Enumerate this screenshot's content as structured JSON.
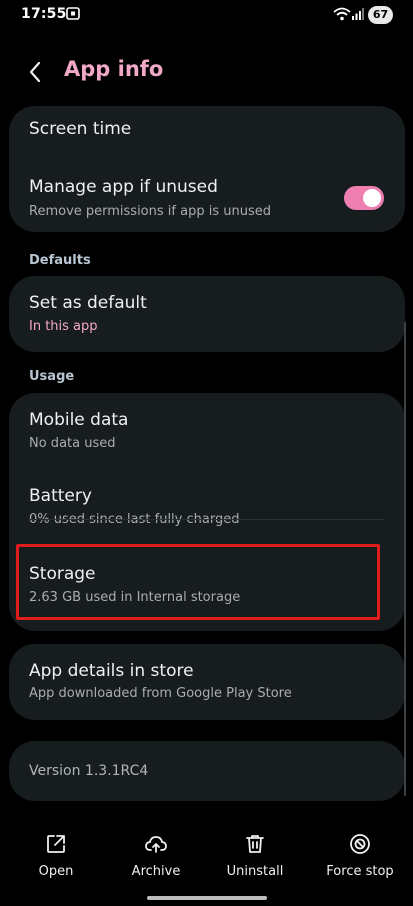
{
  "status_bar": {
    "time": "17:55",
    "battery": "67"
  },
  "header": {
    "title": "App info"
  },
  "items": {
    "screen_time": {
      "label": "Screen time"
    },
    "manage_unused": {
      "label": "Manage app if unused",
      "sub": "Remove permissions if app is unused",
      "enabled": true
    },
    "set_default": {
      "label": "Set as default",
      "sub": "In this app"
    },
    "mobile_data": {
      "label": "Mobile data",
      "sub": "No data used"
    },
    "battery": {
      "label": "Battery",
      "sub": "0% used since last fully charged"
    },
    "storage": {
      "label": "Storage",
      "sub": "2.63 GB used in Internal storage"
    },
    "store": {
      "label": "App details in store",
      "sub": "App downloaded from Google Play Store"
    },
    "version": {
      "label": "Version 1.3.1RC4"
    }
  },
  "sections": {
    "defaults": "Defaults",
    "usage": "Usage"
  },
  "actions": [
    {
      "label": "Open",
      "icon": "open-external-icon"
    },
    {
      "label": "Archive",
      "icon": "cloud-upload-icon"
    },
    {
      "label": "Uninstall",
      "icon": "trash-icon"
    },
    {
      "label": "Force stop",
      "icon": "stop-icon"
    }
  ],
  "colors": {
    "accent": "#f2a9c7",
    "toggle": "#ee7fb0",
    "highlight": "#e01c1c"
  }
}
